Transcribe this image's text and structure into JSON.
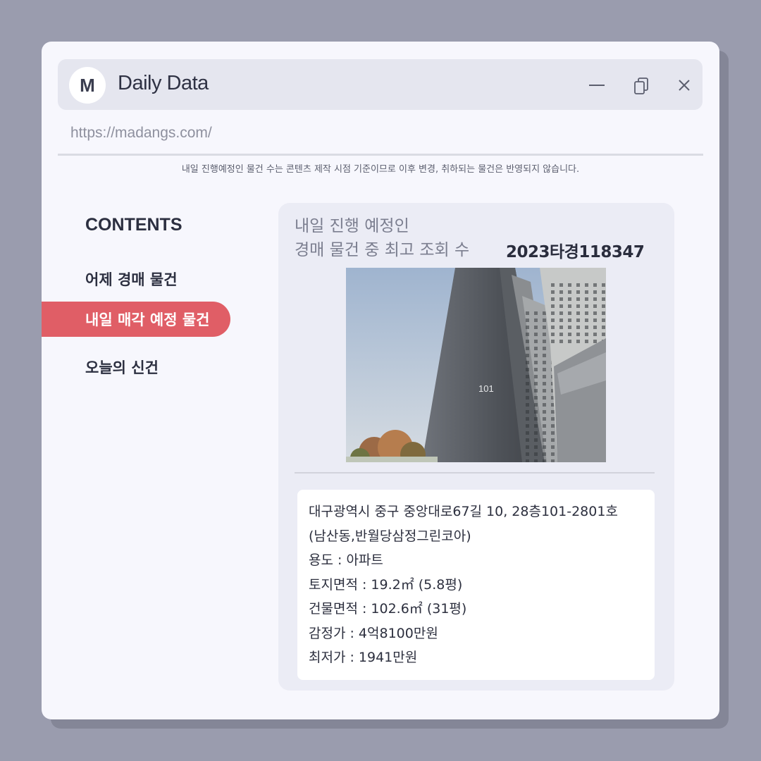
{
  "app": {
    "logo_letter": "M",
    "title": "Daily Data",
    "url": "https://madangs.com/"
  },
  "notice": "내일 진행예정인 물건 수는 콘텐츠 제작 시점 기준이므로 이후 변경, 취하되는 물건은 반영되지 않습니다.",
  "sidebar": {
    "heading": "CONTENTS",
    "items": [
      {
        "label": "어제 경매 물건",
        "active": false
      },
      {
        "label": "내일 매각 예정 물건",
        "active": true
      },
      {
        "label": "오늘의 신건",
        "active": false
      }
    ]
  },
  "panel": {
    "title_line1": "내일 진행 예정인",
    "title_line2": "경매 물건 중 최고 조회 수",
    "case_number": "2023타경118347",
    "building_number": "101",
    "details": [
      "대구광역시 중구 중앙대로67길 10, 28층101-2801호",
      "(남산동,반월당삼정그린코아)",
      "용도 : 아파트",
      "토지면적 : 19.2㎡ (5.8평)",
      "건물면적 : 102.6㎡ (31평)",
      "감정가 :  4억8100만원",
      "최저가 : 1941만원"
    ]
  },
  "colors": {
    "background": "#9a9cae",
    "window": "#f7f7fd",
    "accent": "#e05e66",
    "text_dark": "#2c2f40"
  },
  "icons": [
    "minimize-icon",
    "copy-icon",
    "close-icon"
  ]
}
